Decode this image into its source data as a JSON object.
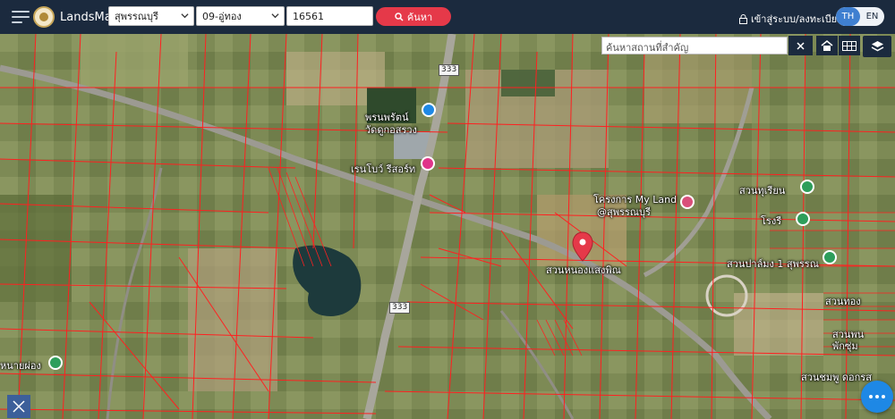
{
  "brand": "LandsMaps",
  "filters": {
    "province": "สุพรรณบุรี",
    "district": "09-อู่ทอง",
    "deed_no": "16561",
    "search_label": "ค้นหา"
  },
  "login_label": "เข้าสู่ระบบ/ลงทะเบียน",
  "lang": {
    "th": "TH",
    "en": "EN"
  },
  "map": {
    "place_search_placeholder": "ค้นหาสถานที่สำคัญ",
    "labels": {
      "temple": "พรนพรัตน์",
      "temple2": "วัดดูกอสรวง",
      "rainbow": "เรนโบว์ รีสอร์ท",
      "project": "โครงการ My Land",
      "project2": "@สุพรรณบุรี",
      "garden": "สวนหนองแสงพิณ",
      "east1": "สวนทุเรียน",
      "east2": "โรงรี",
      "east3": "สวนปาล์มง 1 สุพรรณ",
      "east4": "สวนทอง",
      "east5": "สวนพน",
      "east6": "พักซุ่ม",
      "east7": "สวนชมพู ดอกรส",
      "west1": "หนายผ่อง"
    },
    "road_shields": [
      "333",
      "333"
    ]
  },
  "colors": {
    "header": "#1b2a3e",
    "search_btn": "#e53949",
    "parcel_line": "#ff2020",
    "pin": "#e53949",
    "fab": "#1e88e5"
  }
}
